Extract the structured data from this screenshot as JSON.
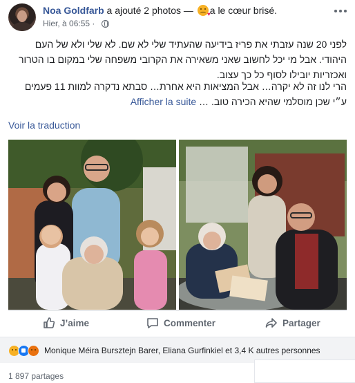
{
  "header": {
    "author": "Noa Goldfarb",
    "activity_prefix": " a ajouté 2 photos — ",
    "feeling": "a le cœur brisé.",
    "time": "Hier, à 06:55 · "
  },
  "post": {
    "paragraph1": "לפני 20 שנה עזבתי את פריז בידיעה שהעתיד שלי לא שם. לא שלי ולא של העם היהודי. אבל מי יכל לחשוב שאני משאירה את הקרובי משפחה שלי במקום בו הטרור ואכזריות יובילו לסוף כל כך עצוב.",
    "paragraph2": "הרי לנו זה לא יקרה… אבל המציאות היא אחרת… סבתא נדקרה למוות 11 פעמים ע״י שכן מוסלמי שהיא הכירה טוב.",
    "see_more": "Afficher la suite",
    "see_more_ellipsis": "… ",
    "translate": "Voir la traduction"
  },
  "actions": {
    "like": "J’aime",
    "comment": "Commenter",
    "share": "Partager"
  },
  "reactions": {
    "names": "Monique Méira Bursztejn Barer, Eliana Gurfinkiel et 3,4 K autres personnes"
  },
  "shares": "1 897 partages",
  "colors": {
    "link": "#385898",
    "secondary_text": "#606770",
    "like_blue": "#1877f2",
    "reaction_yellow": "#f7b125"
  }
}
